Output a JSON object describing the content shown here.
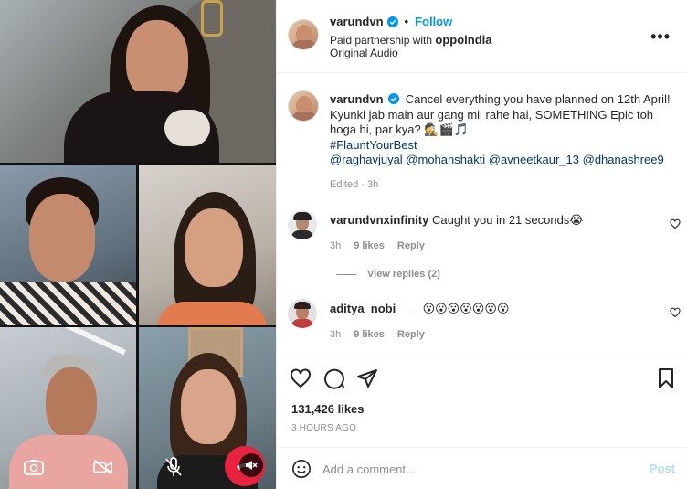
{
  "post": {
    "author": "varundvn",
    "follow_label": "Follow",
    "partnership_prefix": "Paid partnership with",
    "partner": "oppoindia",
    "audio": "Original Audio",
    "more": "•••"
  },
  "caption": {
    "author": "varundvn",
    "line1": "Cancel everything you have planned on 12th April! Kyunki jab main aur gang mil rahe hai, SOMETHING Epic toh hoga hi, par kya? 🕵️🎬🎵",
    "hashtag": "#FlauntYourBest",
    "mentions": "@raghavjuyal @mohanshakti @avneetkaur_13 @dhanashree9",
    "edited": "Edited · 3h"
  },
  "comments": [
    {
      "user": "varundvnxinfinity",
      "text": "Caught you in 21 seconds😭",
      "time": "3h",
      "likes": "9 likes",
      "reply": "Reply"
    },
    {
      "user": "aditya_nobi___",
      "text": "😮😮😮😮😮😮😮",
      "time": "3h",
      "likes": "9 likes",
      "reply": "Reply"
    }
  ],
  "view_replies": "View replies (2)",
  "likes_count": "131,426 likes",
  "timestamp": "3 HOURS AGO",
  "add_comment": {
    "placeholder": "Add a comment...",
    "post_label": "Post"
  },
  "icons": {
    "verified": "verified-badge-icon",
    "heart": "heart-icon",
    "comment": "comment-icon",
    "share": "share-icon",
    "save": "bookmark-icon",
    "emoji": "emoji-icon",
    "camera_flip": "camera-flip-icon",
    "video_off": "video-off-icon",
    "mic_off": "mic-off-icon",
    "end_call": "end-call-icon",
    "muted": "muted-speaker-icon"
  },
  "colors": {
    "accent": "#0095f6",
    "end_call": "#e8233f",
    "post_disabled": "#b2dffc"
  }
}
